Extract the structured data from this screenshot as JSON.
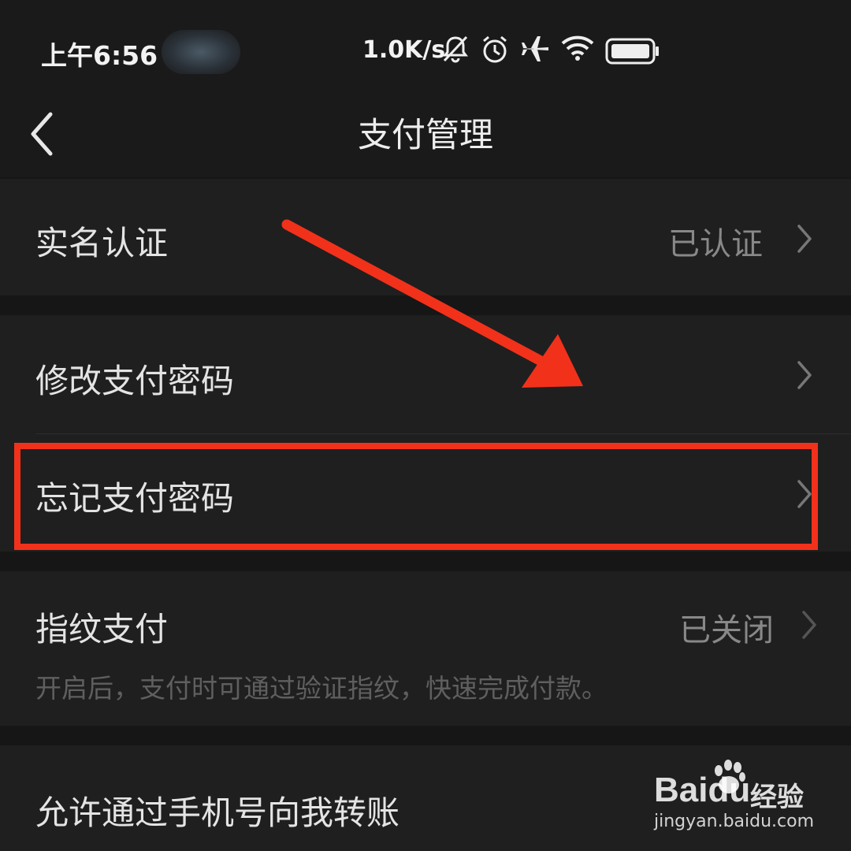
{
  "status_bar": {
    "time": "上午6:56",
    "net_speed": "1.0K/s",
    "icons": [
      "mute-bell-icon",
      "alarm-icon",
      "airplane-icon",
      "wifi-icon",
      "battery-icon"
    ]
  },
  "header": {
    "title": "支付管理",
    "back_icon": "chevron-left-icon"
  },
  "settings": {
    "real_name": {
      "label": "实名认证",
      "value": "已认证"
    },
    "change_password": {
      "label": "修改支付密码"
    },
    "forgot_password": {
      "label": "忘记支付密码"
    },
    "fingerprint": {
      "label": "指纹支付",
      "value": "已关闭",
      "description": "开启后，支付时可通过验证指纹，快速完成付款。"
    },
    "phone_transfer": {
      "label": "允许通过手机号向我转账"
    }
  },
  "annotation": {
    "arrow_color": "#f2311b",
    "box_color": "#f2311b"
  },
  "watermark": {
    "brand": "Baidu",
    "suffix": "经验",
    "url": "jingyan.baidu.com"
  }
}
